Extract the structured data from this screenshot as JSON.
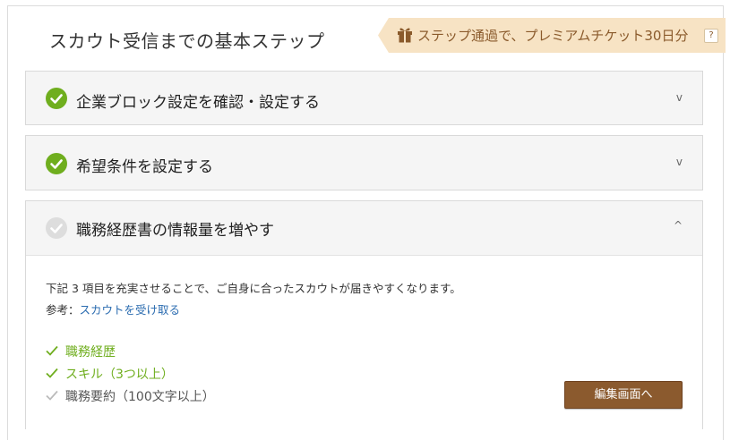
{
  "header": {
    "title": "スカウト受信までの基本ステップ",
    "ribbon_text": "ステップ通過で、プレミアムチケット30日分",
    "ribbon_help": "?"
  },
  "steps": [
    {
      "label": "企業ブロック設定を確認・設定する",
      "status": "done",
      "toggle": "v"
    },
    {
      "label": "希望条件を設定する",
      "status": "done",
      "toggle": "v"
    },
    {
      "label": "職務経歴書の情報量を増やす",
      "status": "incomplete",
      "toggle": "^"
    }
  ],
  "step3_detail": {
    "description": "下記 3 項目を充実させることで、ご自身に合ったスカウトが届きやすくなります。",
    "ref_prefix": "参考：",
    "ref_link": "スカウトを受け取る",
    "requirements": [
      {
        "label": "職務経歴",
        "done": true
      },
      {
        "label": "スキル（3つ以上）",
        "done": true
      },
      {
        "label": "職務要約（100文字以上）",
        "done": false
      }
    ],
    "edit_button": "編集画面へ"
  },
  "colors": {
    "check_green": "#6fae1e",
    "check_gray": "#dddddd",
    "req_done": "#6fae1e",
    "req_pending": "#555555",
    "button_brown": "#8b5a2e",
    "ribbon_bg": "#f7e3c4",
    "ribbon_text": "#8a5a2b",
    "link": "#2b6cb0"
  },
  "icons": {
    "gift": "gift-icon",
    "check": "check-circle-icon",
    "chevron_down": "chevron-down-icon",
    "chevron_up": "chevron-up-icon",
    "req_check": "checkmark-icon"
  }
}
